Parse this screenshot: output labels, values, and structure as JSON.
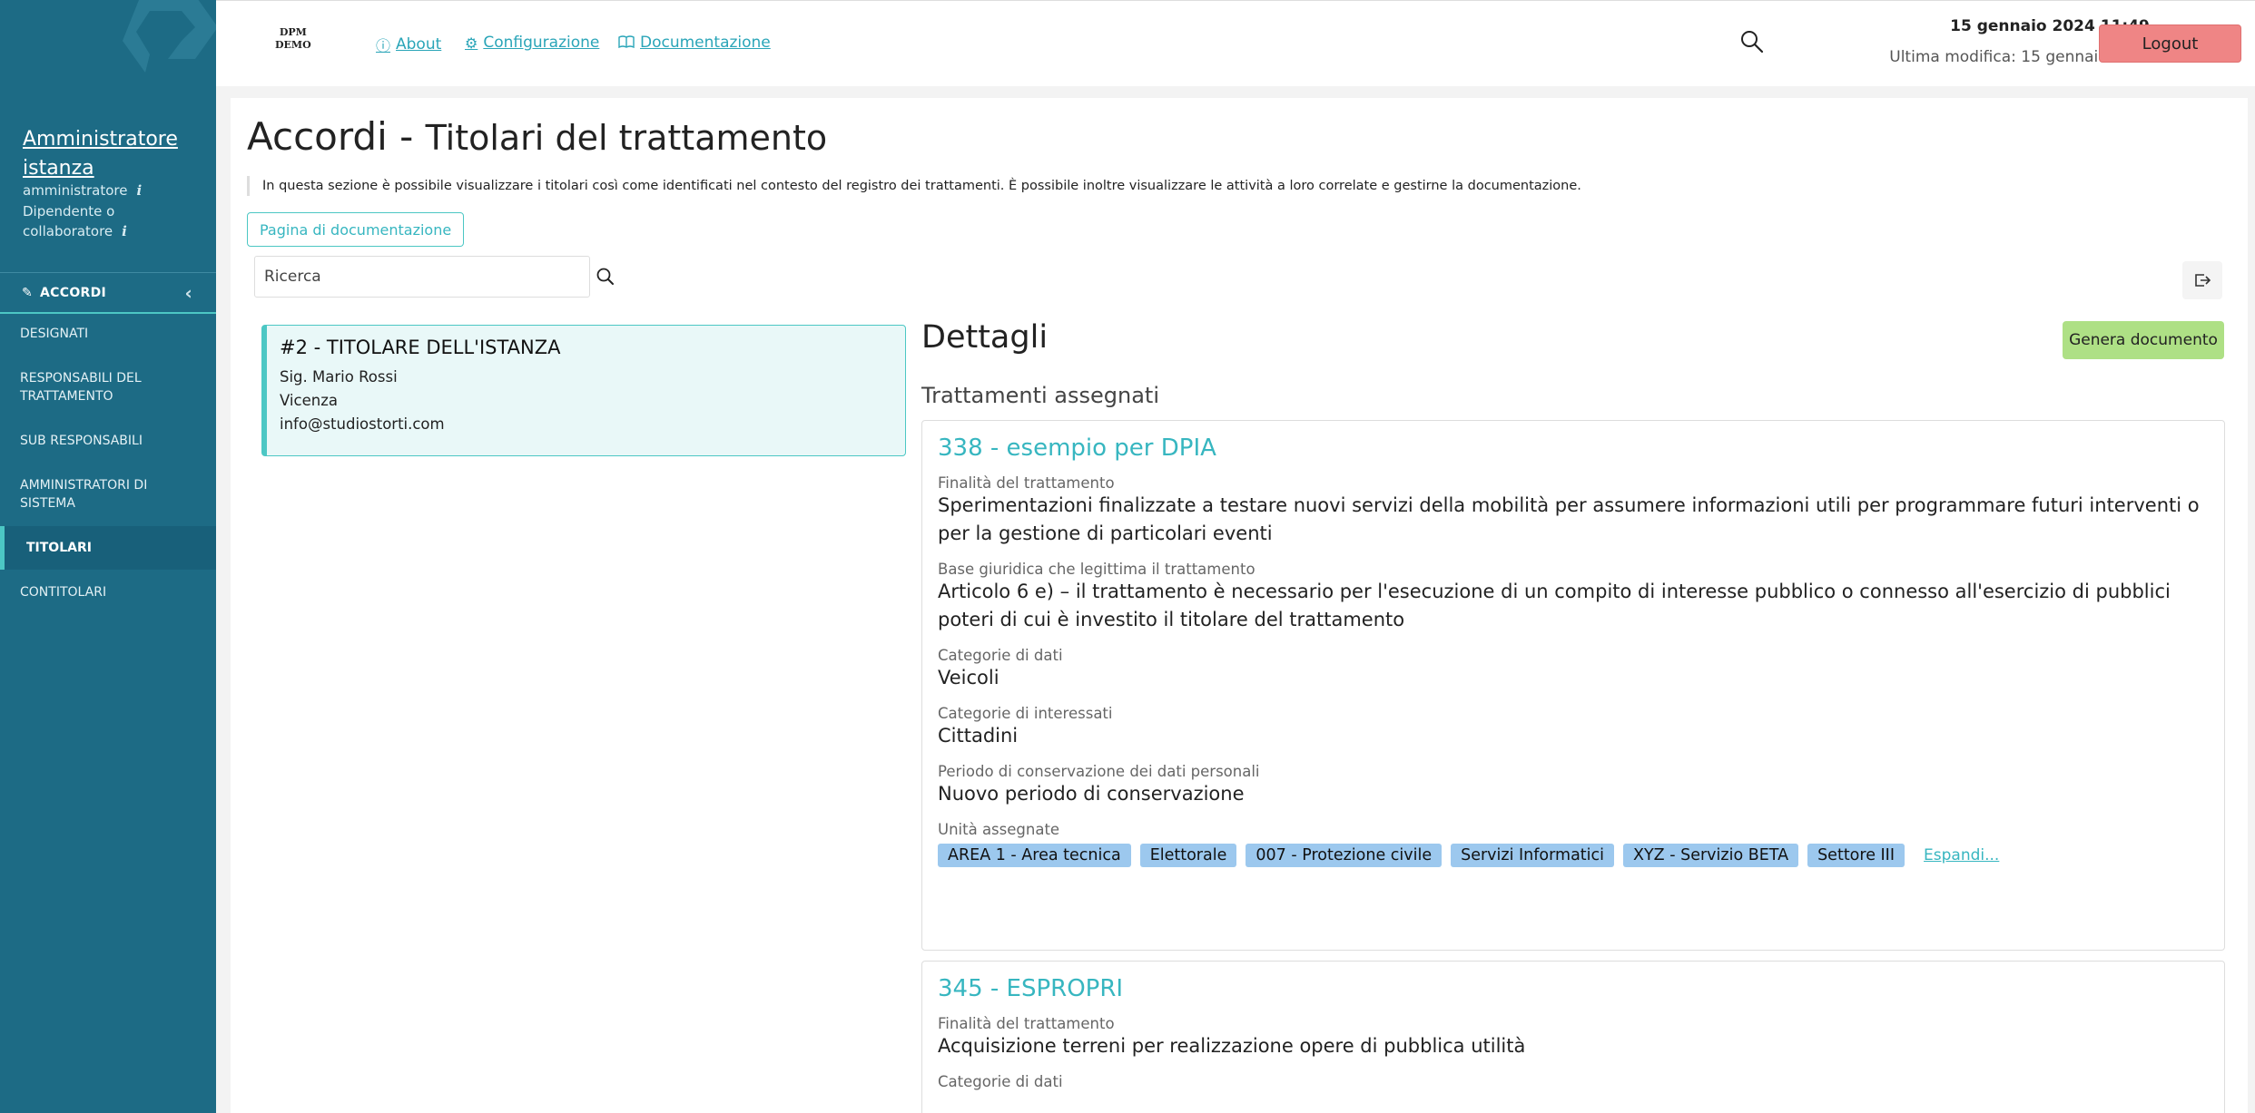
{
  "brand": {
    "line1": "DPM",
    "line2": "DEMO"
  },
  "topbar": {
    "links": [
      {
        "icon": "info-circle-icon",
        "label": " About "
      },
      {
        "icon": "gear-icon",
        "label": " Configurazione "
      },
      {
        "icon": "book-icon",
        "label": " Documentazione"
      }
    ],
    "date": "15 gennaio 2024 11:49",
    "last_modified": "Ultima modifica: 15 gennaio 2024 10:10",
    "logout_label": "Logout"
  },
  "sidebar": {
    "user_name": "Amministratore istanza",
    "roles": [
      {
        "label": "amministratore",
        "info": "i"
      },
      {
        "label": "Dipendente o collaboratore",
        "info": "i"
      }
    ],
    "section": {
      "label": "ACCORDI",
      "icon": "pen-icon"
    },
    "items": [
      {
        "label": "DESIGNATI"
      },
      {
        "label": "RESPONSABILI DEL TRATTAMENTO"
      },
      {
        "label": "SUB RESPONSABILI"
      },
      {
        "label": "AMMINISTRATORI DI SISTEMA"
      },
      {
        "label": "TITOLARI",
        "active": true
      },
      {
        "label": "CONTITOLARI"
      }
    ]
  },
  "page": {
    "title": "Accordi - ",
    "subtitle": "Titolari del trattamento",
    "intro": "In questa sezione è possibile visualizzare i titolari così come identificati nel contesto del registro dei trattamenti. È possibile inoltre visualizzare le attività a loro correlate e gestirne la documentazione.",
    "doc_button": "Pagina di documentazione",
    "search_placeholder": "Ricerca"
  },
  "titolare": {
    "name": "#2 - TITOLARE DELL'ISTANZA",
    "person": "Sig. Mario Rossi",
    "city": "Vicenza",
    "email": "info@studiostorti.com"
  },
  "details": {
    "title": "Dettagli",
    "generate_button": "Genera documento",
    "assigned_heading": "Trattamenti assegnati",
    "labels": {
      "finalita": "Finalità del trattamento",
      "base": "Base giuridica che legittima il trattamento",
      "categorie_dati": "Categorie di dati",
      "categorie_interessati": "Categorie di interessati",
      "periodo": "Periodo di conservazione dei dati personali",
      "unita": "Unità assegnate"
    },
    "treatments": [
      {
        "title": "338 - esempio per DPIA",
        "finalita": "Sperimentazioni finalizzate a testare nuovi servizi della mobilità per assumere informazioni utili per programmare futuri interventi o per la gestione di particolari eventi",
        "base": "Articolo 6 e) – il trattamento è necessario per l'esecuzione di un compito di interesse pubblico o connesso all'esercizio di pubblici poteri di cui è investito il titolare del trattamento",
        "categorie_dati": "Veicoli",
        "categorie_interessati": "Cittadini",
        "periodo": "Nuovo periodo di conservazione",
        "unita": [
          "AREA 1 - Area tecnica",
          "Elettorale",
          "007 - Protezione civile",
          "Servizi Informatici",
          "XYZ - Servizio BETA",
          "Settore III"
        ],
        "expand": "Espandi..."
      },
      {
        "title": "345 - ESPROPRI",
        "finalita": "Acquisizione terreni per realizzazione opere di pubblica utilità"
      }
    ]
  },
  "colors": {
    "sidebar_bg": "#1d6b85",
    "accent": "#4cc7c4",
    "logout": "#ef8585",
    "generate": "#aee085",
    "tag": "#9cc8ee"
  }
}
